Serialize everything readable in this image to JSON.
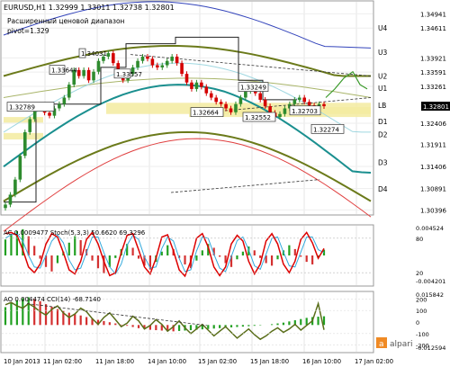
{
  "header": {
    "title": "EURUSD,H1  1.32999 1.33011 1.32738 1.32801",
    "subtitle": "Расширенный ценовой диапазон",
    "pivot": "pivot=1.329"
  },
  "main_panel": {
    "price_axis": [
      {
        "label": "1.34941",
        "value": 1.34941
      },
      {
        "label": "1.34611",
        "value": 1.34611
      },
      {
        "label": "1.33921",
        "value": 1.33921
      },
      {
        "label": "1.33591",
        "value": 1.33591
      },
      {
        "label": "1.33261",
        "value": 1.33261
      },
      {
        "label": "1.32406",
        "value": 1.32406
      },
      {
        "label": "1.31911",
        "value": 1.31911
      },
      {
        "label": "1.31406",
        "value": 1.31406
      },
      {
        "label": "1.30891",
        "value": 1.30891
      },
      {
        "label": "1.30396",
        "value": 1.30396
      }
    ],
    "current_price": "1.32801",
    "levels": [
      {
        "name": "U4",
        "value": 1.3462
      },
      {
        "name": "U3",
        "value": 1.3405
      },
      {
        "name": "U2",
        "value": 1.335
      },
      {
        "name": "U1",
        "value": 1.3322
      },
      {
        "name": "LB",
        "value": 1.3282
      },
      {
        "name": "D1",
        "value": 1.3245
      },
      {
        "name": "D2",
        "value": 1.3215
      },
      {
        "name": "D3",
        "value": 1.315
      },
      {
        "name": "D4",
        "value": 1.3088
      }
    ],
    "price_boxes": [
      {
        "text": "1.32789",
        "value": 1.32789
      },
      {
        "text": "1.33644",
        "value": 1.33644
      },
      {
        "text": "1.34031",
        "value": 1.34031
      },
      {
        "text": "1.33557",
        "value": 1.33557
      },
      {
        "text": "1.33249",
        "value": 1.33249
      },
      {
        "text": "1.32664",
        "value": 1.32664
      },
      {
        "text": "1.32552",
        "value": 1.32552
      },
      {
        "text": "1.32703",
        "value": 1.32703
      },
      {
        "text": "1.32274",
        "value": 1.32274
      }
    ]
  },
  "ac_panel": {
    "header": "AC 0.0009477  Stoch(5,3,3) 50.6620 69.3296",
    "axis": [
      {
        "label": "0.004524",
        "value": 0.004524
      },
      {
        "label": "80",
        "value": 80
      },
      {
        "label": "20",
        "value": 20
      },
      {
        "label": "-0.004201",
        "value": -0.004201
      }
    ]
  },
  "ao_panel": {
    "header": "AO 0.004474  CCI(14) -68.7140",
    "axis": [
      {
        "label": "0.015842",
        "value": 0.015842
      },
      {
        "label": "200",
        "value": 200
      },
      {
        "label": "100",
        "value": 100
      },
      {
        "label": "0",
        "value": 0
      },
      {
        "label": "-100",
        "value": -100
      },
      {
        "label": "-200",
        "value": -200
      },
      {
        "label": "-0.012594",
        "value": -0.012594
      }
    ]
  },
  "time_axis": [
    "10 Jan 2013",
    "11 Jan 02:00",
    "11 Jan 18:00",
    "14 Jan 10:00",
    "15 Jan 02:00",
    "15 Jan 18:00",
    "16 Jan 10:00",
    "17 Jan 02:00"
  ],
  "watermark": "alpari",
  "colors": {
    "bull_candle": "#2e8b2e",
    "bear_candle": "#d40000",
    "teal_ma": "#1a8f8f",
    "olive_band": "#6b7a1a",
    "blue_band": "#3344bb",
    "red_band": "#e04040",
    "zone_fill": "#f3eba0",
    "stoch_main": "#dd0000",
    "stoch_signal": "#33aadd",
    "cci_line": "#5a6e1a",
    "osc_up": "#22a022",
    "osc_down": "#d43030"
  },
  "chart_data": {
    "type": "candlestick",
    "symbol": "EURUSD",
    "timeframe": "H1",
    "ohlc_last": {
      "open": 1.32999,
      "high": 1.33011,
      "low": 1.32738,
      "close": 1.32801
    },
    "close_path": [
      1.3052,
      1.3075,
      1.311,
      1.3165,
      1.322,
      1.325,
      1.3275,
      1.3279,
      1.3265,
      1.3258,
      1.3275,
      1.3285,
      1.33,
      1.333,
      1.3364,
      1.335,
      1.3364,
      1.334,
      1.336,
      1.3385,
      1.3395,
      1.3403,
      1.338,
      1.336,
      1.334,
      1.3355,
      1.337,
      1.3385,
      1.3395,
      1.339,
      1.3375,
      1.337,
      1.3375,
      1.3385,
      1.3395,
      1.338,
      1.3355,
      1.3335,
      1.332,
      1.3335,
      1.3325,
      1.331,
      1.33,
      1.329,
      1.3285,
      1.3275,
      1.3266,
      1.3285,
      1.33,
      1.3315,
      1.3325,
      1.331,
      1.3295,
      1.328,
      1.3265,
      1.3255,
      1.3262,
      1.3275,
      1.3285,
      1.3295,
      1.33,
      1.329,
      1.3282,
      1.3278,
      1.3285,
      1.328
    ],
    "ac_values": [
      0.0025,
      0.0032,
      0.0038,
      0.0041,
      0.003,
      0.0015,
      -0.0005,
      -0.0018,
      -0.0025,
      -0.0012,
      0.0006,
      0.002,
      0.003,
      0.0024,
      0.001,
      -0.0008,
      -0.002,
      -0.0028,
      -0.0018,
      -0.0004,
      0.001,
      0.0018,
      0.0012,
      -0.0005,
      -0.0016,
      -0.0022,
      -0.001,
      0.0006,
      0.0016,
      0.001,
      -0.0004,
      -0.0014,
      -0.002,
      -0.0008,
      0.0008,
      0.0018,
      0.0012,
      -0.0002,
      -0.0012,
      -0.0018,
      -0.0006,
      0.0006,
      0.0014,
      0.0008,
      -0.0004,
      -0.0012,
      -0.0016,
      -0.0006,
      0.0008,
      0.0016,
      0.001,
      -0.0002,
      -0.001,
      -0.0014,
      -0.0004,
      0.0009
    ],
    "stoch_main": [
      88,
      90,
      85,
      60,
      30,
      20,
      35,
      70,
      88,
      82,
      55,
      25,
      18,
      40,
      78,
      90,
      70,
      40,
      15,
      20,
      55,
      85,
      88,
      60,
      30,
      18,
      45,
      82,
      86,
      58,
      25,
      14,
      40,
      80,
      88,
      65,
      30,
      15,
      30,
      70,
      85,
      75,
      40,
      18,
      35,
      75,
      88,
      70,
      35,
      20,
      40,
      78,
      90,
      72,
      45,
      62
    ],
    "stoch_signal": [
      80,
      86,
      88,
      75,
      50,
      30,
      28,
      50,
      75,
      86,
      72,
      42,
      25,
      28,
      55,
      82,
      82,
      55,
      30,
      18,
      35,
      68,
      85,
      78,
      48,
      28,
      30,
      62,
      82,
      75,
      45,
      22,
      25,
      58,
      82,
      80,
      52,
      28,
      22,
      48,
      76,
      82,
      60,
      32,
      26,
      52,
      80,
      82,
      56,
      32,
      30,
      56,
      82,
      82,
      60,
      55
    ],
    "ao_values": [
      0.009,
      0.011,
      0.0125,
      0.0135,
      0.014,
      0.0132,
      0.012,
      0.0105,
      0.0092,
      0.008,
      0.007,
      0.0062,
      0.0055,
      0.0048,
      0.004,
      0.0032,
      0.0026,
      0.002,
      0.0014,
      0.0008,
      0.0002,
      -0.0004,
      -0.001,
      -0.0016,
      -0.002,
      -0.0024,
      -0.0026,
      -0.0028,
      -0.003,
      -0.0032,
      -0.003,
      -0.0028,
      -0.0026,
      -0.0024,
      -0.0022,
      -0.002,
      -0.0018,
      -0.0016,
      -0.0014,
      -0.0012,
      -0.001,
      -0.0008,
      -0.0006,
      -0.0004,
      -0.0002,
      0.0,
      0.0004,
      0.0008,
      0.0012,
      0.0018,
      0.0024,
      0.003,
      0.0036,
      0.004,
      0.0042,
      0.0044
    ],
    "cci_values": [
      150,
      170,
      140,
      120,
      160,
      130,
      90,
      60,
      110,
      140,
      80,
      40,
      70,
      120,
      90,
      30,
      -20,
      40,
      80,
      20,
      -40,
      -10,
      50,
      10,
      -60,
      -30,
      20,
      -20,
      -80,
      -40,
      10,
      -50,
      -100,
      -60,
      -20,
      -70,
      -120,
      -80,
      -40,
      -90,
      -140,
      -100,
      -60,
      -110,
      -150,
      -120,
      -80,
      -50,
      -90,
      -60,
      -20,
      -70,
      -30,
      10,
      160,
      -68
    ]
  }
}
